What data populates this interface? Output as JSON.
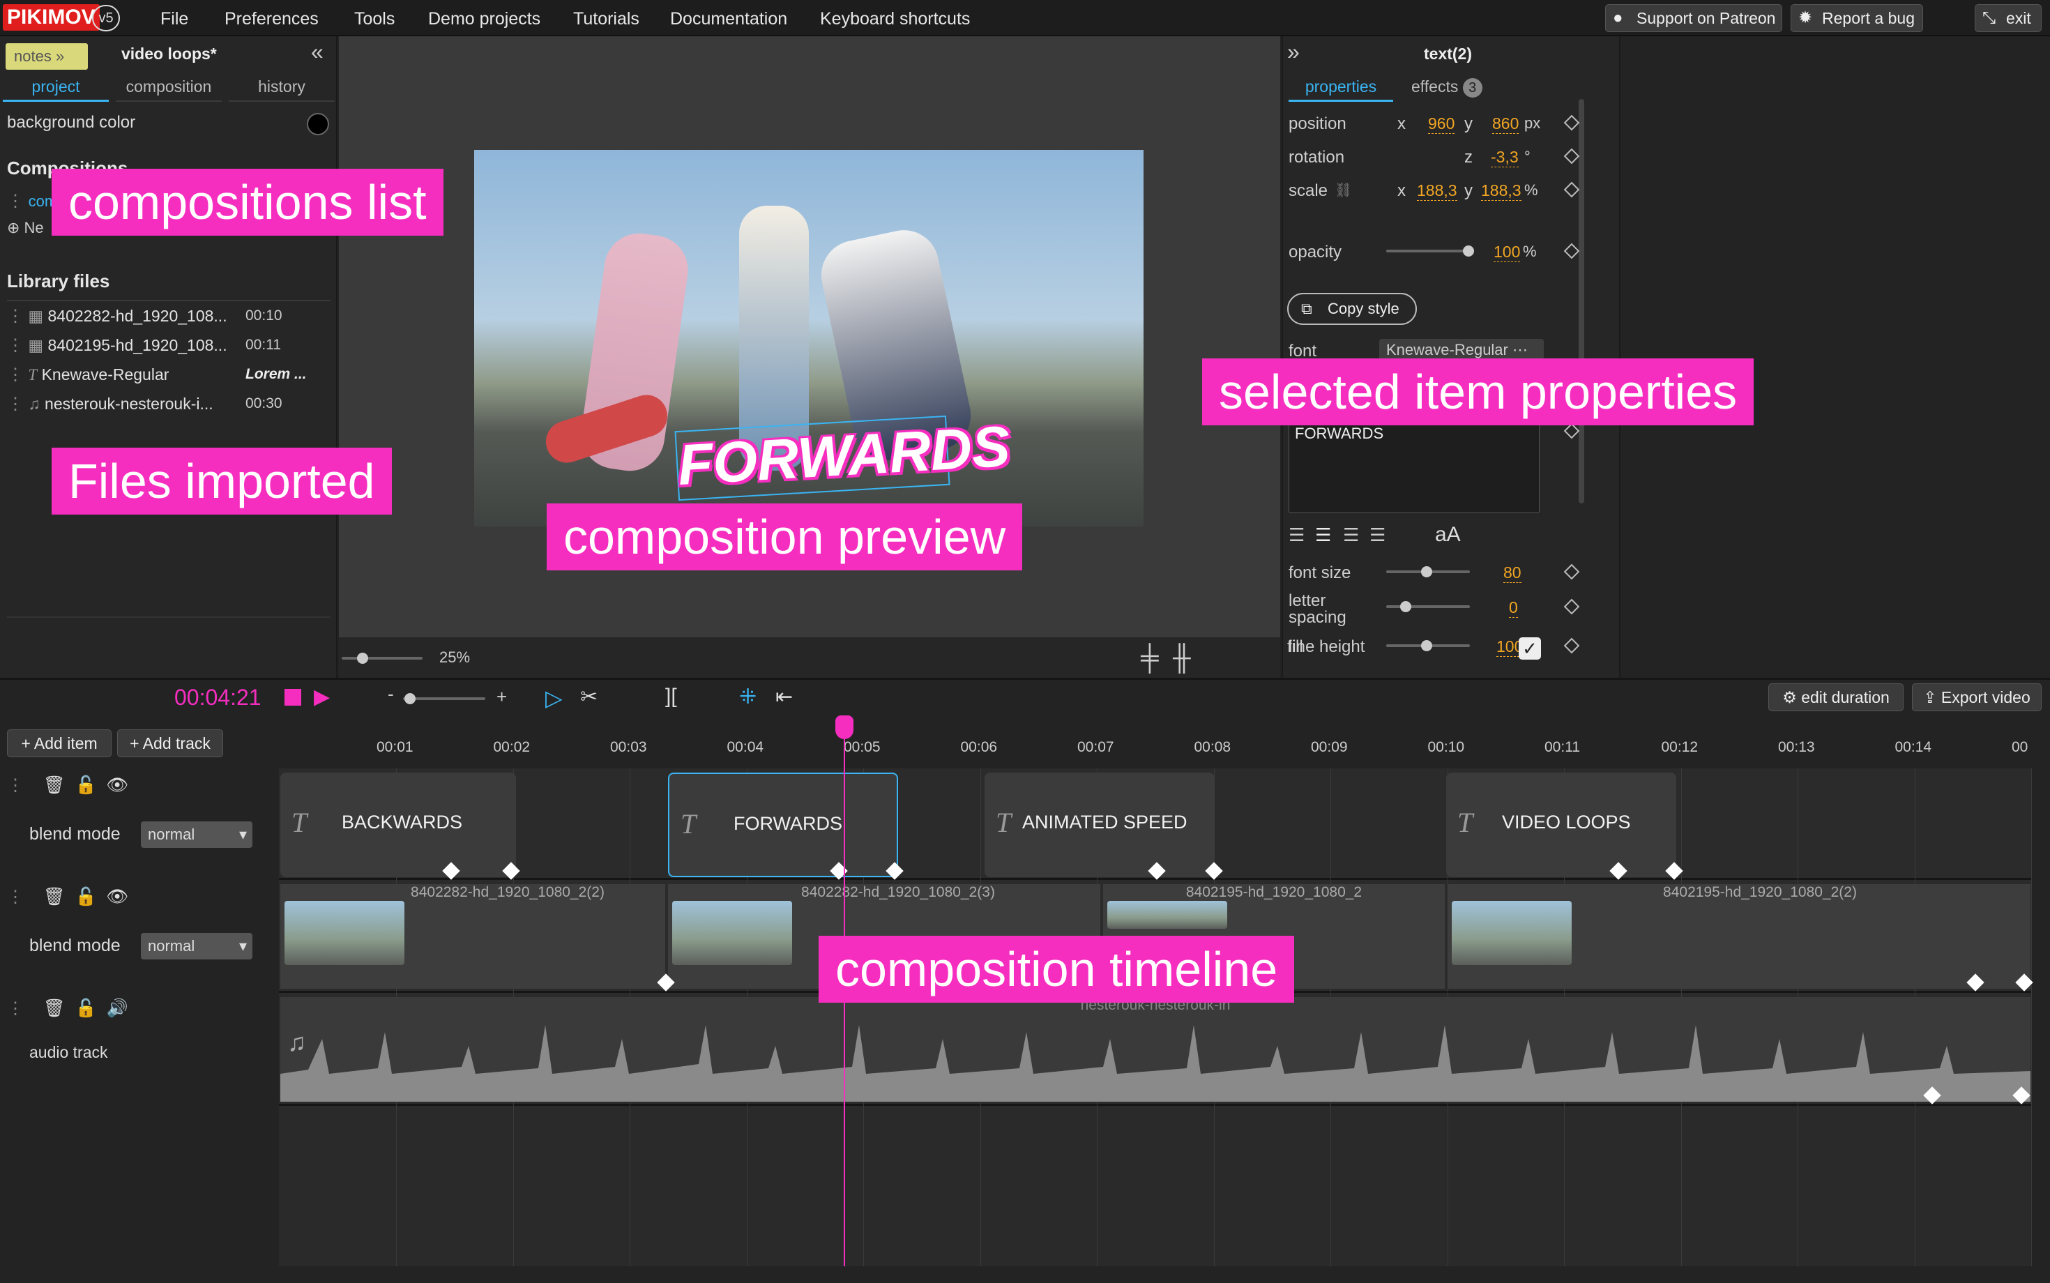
{
  "app": {
    "logo": "PIKIMOV",
    "version": "v5"
  },
  "menu": [
    "File",
    "Preferences",
    "Tools",
    "Demo projects",
    "Tutorials",
    "Documentation",
    "Keyboard shortcuts"
  ],
  "topbuttons": {
    "patreon": "Support on Patreon",
    "bug": "Report a bug",
    "exit": "exit"
  },
  "left": {
    "notes": "notes",
    "project_name": "video loops*",
    "tabs": [
      "project",
      "composition",
      "history"
    ],
    "background_color": "background color",
    "compositions_header": "Compositions",
    "comp_item": "com",
    "new_item": "Ne",
    "library_header": "Library files",
    "files": [
      {
        "name": "8402282-hd_1920_108...",
        "duration": "00:10"
      },
      {
        "name": "8402195-hd_1920_108...",
        "duration": "00:11"
      },
      {
        "name": "Knewave-Regular",
        "duration": "Lorem ..."
      },
      {
        "name": "nesterouk-nesterouk-i...",
        "duration": "00:30"
      }
    ]
  },
  "preview": {
    "zoom": "25%",
    "overlay_text": "FORWARDS"
  },
  "annotations": {
    "compositions_list": "compositions list",
    "files_imported": "Files imported",
    "composition_preview": "composition preview",
    "selected_item_properties": "selected item properties",
    "composition_timeline": "composition timeline"
  },
  "right": {
    "title": "text(2)",
    "tabs": [
      "properties",
      "effects"
    ],
    "effects_count": "3",
    "position": {
      "label": "position",
      "x": "960",
      "y": "860",
      "unit": "px"
    },
    "rotation": {
      "label": "rotation",
      "z": "-3,3",
      "unit": "°"
    },
    "scale": {
      "label": "scale",
      "x": "188,3",
      "y": "188,3",
      "unit": "%"
    },
    "opacity": {
      "label": "opacity",
      "value": "100",
      "unit": "%",
      "level": 1.0
    },
    "copy_style": "Copy style",
    "font": {
      "label": "font",
      "value": "Knewave-Regular"
    },
    "text_value": "FORWARDS",
    "case_toggle": "aA",
    "font_size": {
      "label": "font size",
      "value": "80"
    },
    "letter_spacing": {
      "label": "letter spacing",
      "value": "0"
    },
    "line_height": {
      "label": "line height",
      "value": "100"
    },
    "fill": "fill"
  },
  "timeline": {
    "timecode": "00:04:21",
    "zoom_minus": "-",
    "zoom_plus": "+",
    "buttons": {
      "add_item": "Add item",
      "add_track": "Add track",
      "edit_duration": "edit duration",
      "export": "Export video"
    },
    "ticks": [
      "00:01",
      "00:02",
      "00:03",
      "00:04",
      "00:05",
      "00:06",
      "00:07",
      "00:08",
      "00:09",
      "00:10",
      "00:11",
      "00:12",
      "00:13",
      "00:14",
      "00"
    ],
    "text_clips": [
      "BACKWARDS",
      "FORWARDS",
      "ANIMATED SPEED",
      "VIDEO LOOPS"
    ],
    "video_clips": [
      "8402282-hd_1920_1080_2(2)",
      "8402282-hd_1920_1080_2(3)",
      "8402195-hd_1920_1080_2",
      "8402195-hd_1920_1080_2(2)"
    ],
    "blend_label": "blend mode",
    "blend_value": "normal",
    "audio_track": "audio track",
    "audio_clip": "nesterouk-nesterouk-in"
  },
  "colors": {
    "accent": "#3ab4f2",
    "playhead": "#f62ec0",
    "annotation": "#f62ec0",
    "value": "#f2a623"
  }
}
